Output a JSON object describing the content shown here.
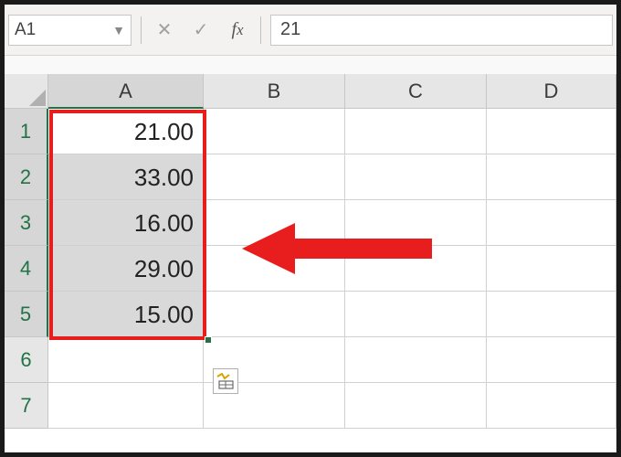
{
  "formula_bar": {
    "name_box_value": "A1",
    "formula_value": "21"
  },
  "columns": [
    "A",
    "B",
    "C",
    "D"
  ],
  "rows": [
    "1",
    "2",
    "3",
    "4",
    "5",
    "6",
    "7"
  ],
  "cells": {
    "A1": "21.00",
    "A2": "33.00",
    "A3": "16.00",
    "A4": "29.00",
    "A5": "15.00"
  },
  "selection": {
    "active_cell": "A1",
    "range": "A1:A5",
    "selected_column": "A",
    "selected_rows": [
      "1",
      "2",
      "3",
      "4",
      "5"
    ]
  },
  "annotation": {
    "highlight_color": "#e81e1e",
    "arrow_points_to": "A3"
  },
  "icons": {
    "quick_analysis": "quick-analysis-icon"
  }
}
